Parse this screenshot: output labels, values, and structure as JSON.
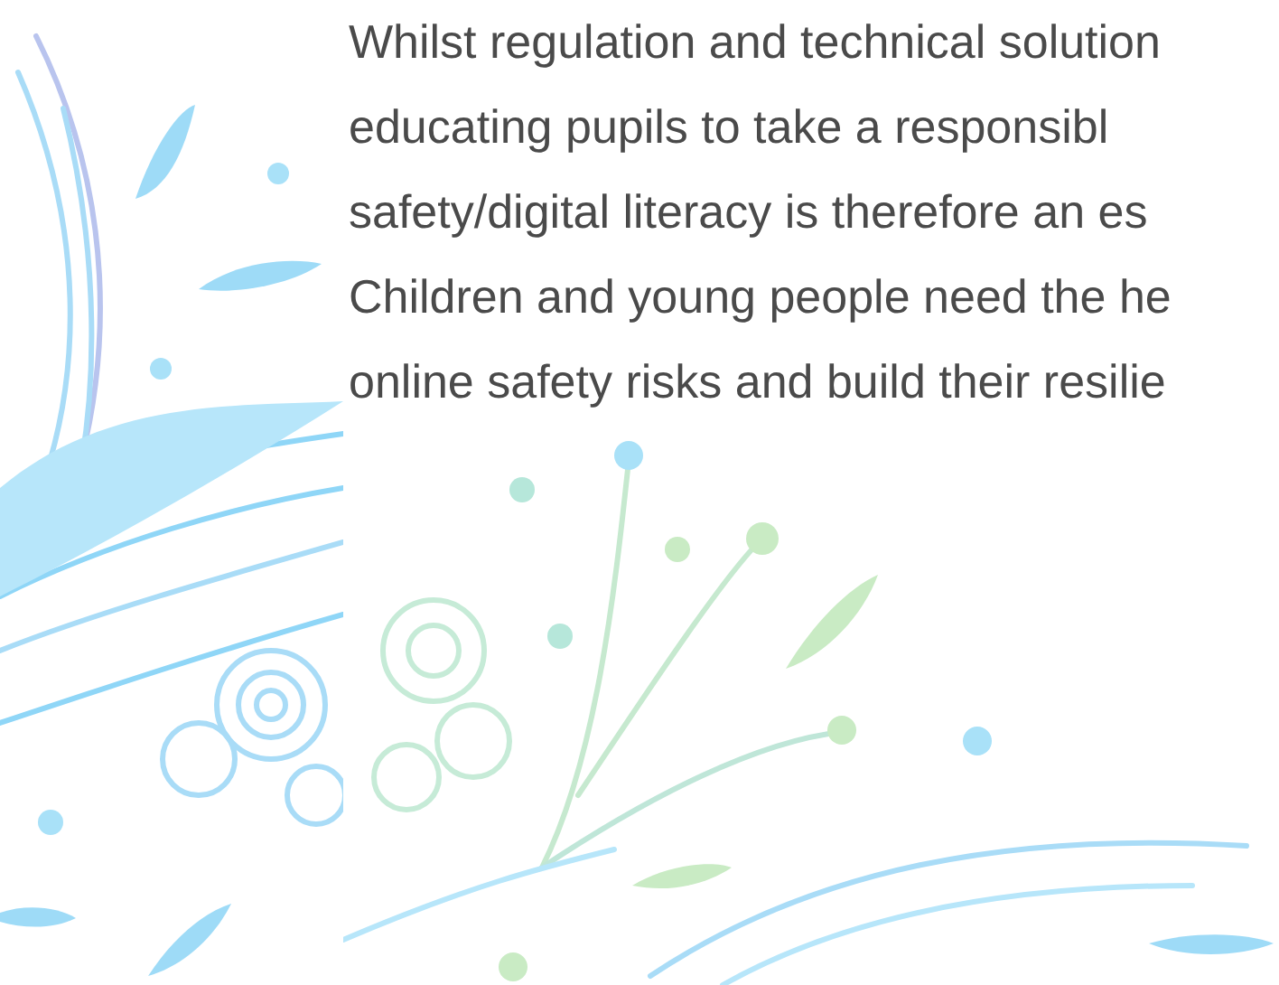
{
  "paragraph": {
    "lines": [
      "Whilst regulation and technical solution",
      "educating pupils to take a responsibl",
      "safety/digital literacy is therefore an es",
      "Children and young people need the he",
      "online safety risks and build their resilie"
    ]
  }
}
